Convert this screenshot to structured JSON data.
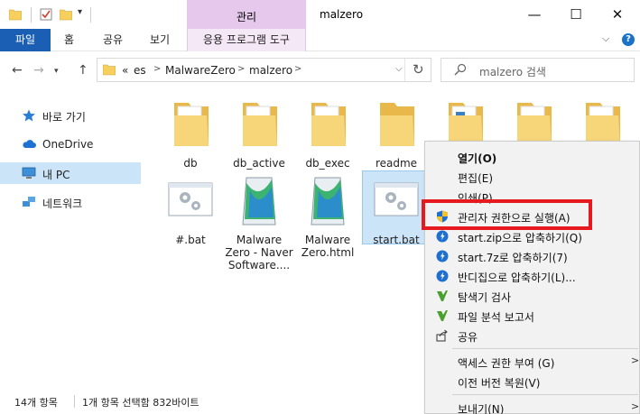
{
  "window": {
    "title": "malzero",
    "context_tab_header": "관리",
    "minimize_glyph": "—",
    "maximize_glyph": "☐",
    "close_glyph": "✕"
  },
  "ribbon": {
    "file_tab": "파일",
    "tabs": [
      "홈",
      "공유",
      "보기"
    ],
    "app_tools_tab": "응용 프로그램 도구",
    "expand_glyph": "⌵",
    "help_glyph": "?"
  },
  "address": {
    "segments": [
      "es",
      "MalwareZero",
      "malzero"
    ],
    "overflow": "«",
    "separator": ">"
  },
  "search": {
    "placeholder": "malzero 검색"
  },
  "sidebar": {
    "items": [
      {
        "label": "바로 가기",
        "icon": "star-icon"
      },
      {
        "label": "OneDrive",
        "icon": "cloud-icon"
      },
      {
        "label": "내 PC",
        "icon": "computer-icon",
        "selected": true
      },
      {
        "label": "네트워크",
        "icon": "network-icon"
      }
    ]
  },
  "files": [
    {
      "name": "db",
      "type": "folder"
    },
    {
      "name": "db_active",
      "type": "folder"
    },
    {
      "name": "db_exec",
      "type": "folder"
    },
    {
      "name": "readme",
      "type": "folder"
    },
    {
      "name": "",
      "type": "folder"
    },
    {
      "name": "",
      "type": "folder"
    },
    {
      "name": "",
      "type": "folder"
    },
    {
      "name": "#.bat",
      "type": "bat"
    },
    {
      "name": "Malware Zero - Naver Software....",
      "type": "html"
    },
    {
      "name": "Malware Zero.html",
      "type": "html"
    },
    {
      "name": "start.bat",
      "type": "bat",
      "selected": true
    }
  ],
  "status": {
    "item_count": "14개 항목",
    "selection": "1개 항목 선택함 832바이트"
  },
  "context_menu": {
    "items": [
      {
        "label": "열기(O)",
        "bold": true,
        "icon": ""
      },
      {
        "label": "편집(E)",
        "icon": ""
      },
      {
        "label": "인쇄(P)",
        "icon": ""
      },
      {
        "label": "관리자 권한으로 실행(A)",
        "icon": "uac-shield-icon",
        "highlighted": true
      },
      {
        "label": "start.zip으로 압축하기(Q)",
        "icon": "bandizip-icon"
      },
      {
        "label": "start.7z로 압축하기(7)",
        "icon": "bandizip-icon"
      },
      {
        "label": "반디집으로 압축하기(L)...",
        "icon": "bandizip-icon"
      },
      {
        "label": "탐색기 검사",
        "icon": "scan-icon"
      },
      {
        "label": "파일 분석 보고서",
        "icon": "report-icon"
      },
      {
        "label": "공유",
        "icon": "share-icon"
      },
      {
        "label": "액세스 권한 부여 (G)",
        "icon": "",
        "submenu": true
      },
      {
        "label": "이전 버전 복원(V)",
        "icon": ""
      },
      {
        "label": "보내기(N)",
        "icon": "",
        "submenu": true
      }
    ],
    "submenu_glyph": ">"
  },
  "colors": {
    "accent": "#1a5fb4",
    "context_tab": "#e6c8ec",
    "selection": "#cce4f7",
    "highlight_box": "#e6191e"
  }
}
